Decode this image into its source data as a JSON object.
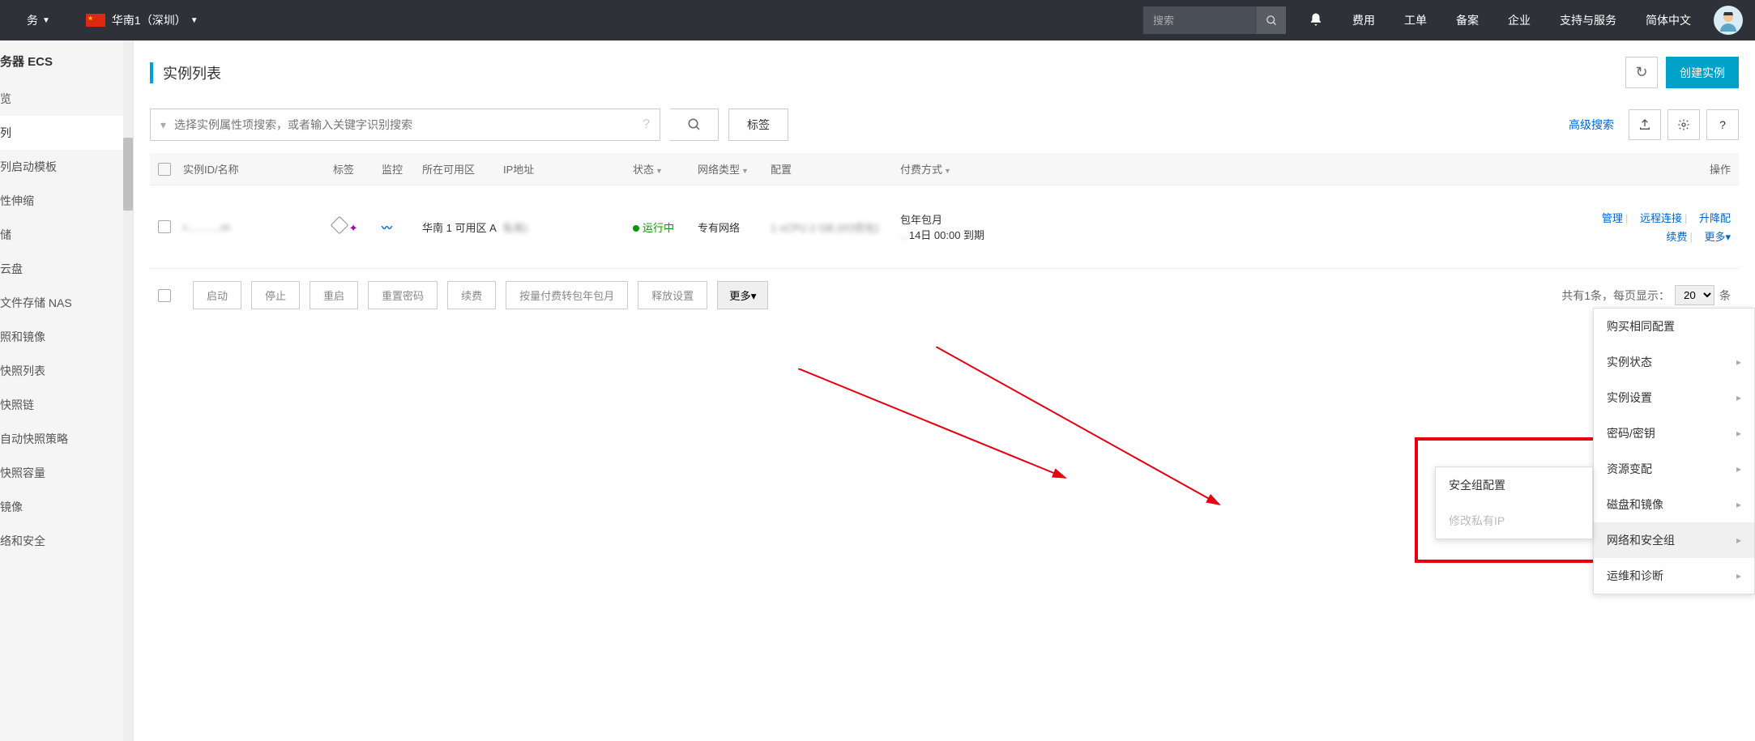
{
  "topnav": {
    "services": "务",
    "region": "华南1（深圳）",
    "search_placeholder": "搜索",
    "items": [
      "费用",
      "工单",
      "备案",
      "企业",
      "支持与服务",
      "简体中文"
    ]
  },
  "sidebar": {
    "title": "务器 ECS",
    "items": [
      "览",
      "列",
      "列启动模板",
      "性伸缩",
      "储",
      "云盘",
      "文件存储 NAS",
      "照和镜像",
      "快照列表",
      "快照链",
      "自动快照策略",
      "快照容量",
      "镜像",
      "络和安全"
    ],
    "active_index": 1
  },
  "page": {
    "title": "实例列表",
    "refresh": "刷新",
    "create": "创建实例",
    "search_placeholder": "选择实例属性项搜索，或者输入关键字识别搜索",
    "tag_btn": "标签",
    "adv_search": "高级搜索"
  },
  "table": {
    "headers": {
      "id": "实例ID/名称",
      "tag": "标签",
      "mon": "监控",
      "zone": "所在可用区",
      "ip": "IP地址",
      "status": "状态",
      "net": "网络类型",
      "conf": "配置",
      "pay": "付费方式",
      "op": "操作"
    },
    "row": {
      "id_blur": "i-...........m",
      "zone": "华南 1 可用区 A",
      "ip_blur": "私有)",
      "status": "运行中",
      "net": "专有网络",
      "conf_blur": "1 vCPU 2 GB (I/O优化)",
      "pay1": "包年包月",
      "pay2": "14日 00:00 到期",
      "actions": {
        "manage": "管理",
        "remote": "远程连接",
        "updown": "升降配",
        "renew": "续费",
        "more": "更多"
      }
    }
  },
  "bulk": {
    "start": "启动",
    "stop": "停止",
    "restart": "重启",
    "resetpw": "重置密码",
    "renew": "续费",
    "convert": "按量付费转包年包月",
    "release": "释放设置",
    "more": "更多",
    "pagination_text": "共有1条，每页显示：",
    "per_page": "20",
    "unit": "条"
  },
  "more_menu": [
    "购买相同配置",
    "实例状态",
    "实例设置",
    "密码/密钥",
    "资源变配",
    "磁盘和镜像",
    "网络和安全组",
    "运维和诊断"
  ],
  "submenu": [
    {
      "label": "安全组配置",
      "disabled": false
    },
    {
      "label": "修改私有IP",
      "disabled": true
    }
  ]
}
